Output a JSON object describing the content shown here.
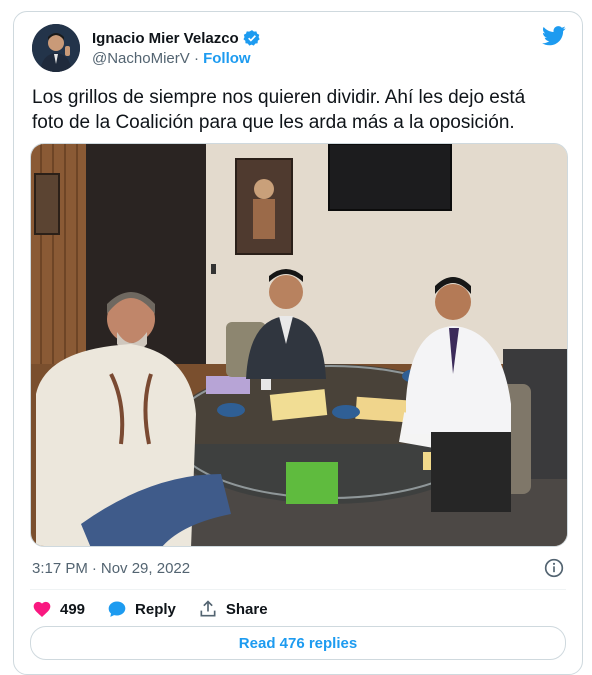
{
  "author": {
    "display_name": "Ignacio Mier Velazco",
    "handle": "@NachoMierV",
    "separator": "·",
    "follow_label": "Follow"
  },
  "tweet": {
    "text": "Los grillos de siempre nos quieren dividir. Ahí les dejo está foto de la Coalición para que les arda más a la oposición.",
    "time": "3:17 PM",
    "date_separator": "·",
    "date": "Nov 29, 2022"
  },
  "actions": {
    "like_count": "499",
    "reply_label": "Reply",
    "share_label": "Share"
  },
  "read_replies_label": "Read 476 replies",
  "icons": [
    "verified-badge-icon",
    "twitter-bird-icon",
    "info-icon",
    "heart-icon",
    "reply-bubble-icon",
    "share-icon"
  ],
  "colors": {
    "accent": "#1d9bf0",
    "like": "#f91880",
    "muted": "#536471",
    "text": "#0f1419"
  }
}
